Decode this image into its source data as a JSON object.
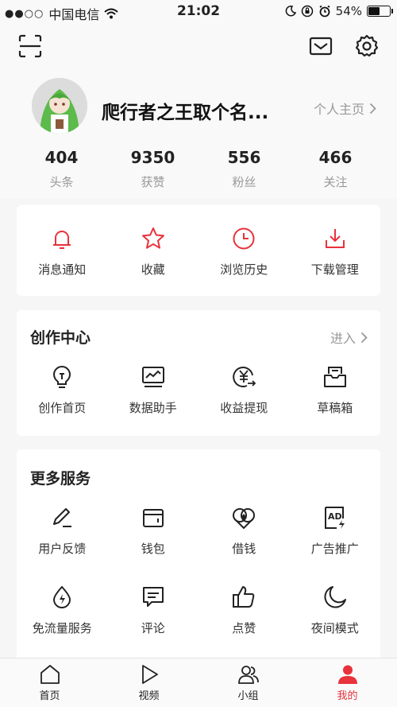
{
  "status_bar": {
    "signal_dots": "●●○○",
    "carrier": "中国电信",
    "time": "21:02",
    "battery_percent": "54%",
    "battery_level": 0.54
  },
  "profile": {
    "username": "爬行者之王取个名...",
    "homepage_link": "个人主页",
    "stats": [
      {
        "value": "404",
        "label": "头条"
      },
      {
        "value": "9350",
        "label": "获赞"
      },
      {
        "value": "556",
        "label": "粉丝"
      },
      {
        "value": "466",
        "label": "关注"
      }
    ]
  },
  "quick_actions": [
    {
      "label": "消息通知",
      "icon": "bell-icon"
    },
    {
      "label": "收藏",
      "icon": "star-icon"
    },
    {
      "label": "浏览历史",
      "icon": "clock-icon"
    },
    {
      "label": "下载管理",
      "icon": "download-icon"
    }
  ],
  "creation_center": {
    "title": "创作中心",
    "enter_label": "进入",
    "items": [
      {
        "label": "创作首页",
        "icon": "lightbulb-icon"
      },
      {
        "label": "数据助手",
        "icon": "chart-monitor-icon"
      },
      {
        "label": "收益提现",
        "icon": "yuan-coin-icon"
      },
      {
        "label": "草稿箱",
        "icon": "drafts-icon"
      }
    ]
  },
  "more_services": {
    "title": "更多服务",
    "rows": [
      [
        {
          "label": "用户反馈",
          "icon": "pen-icon"
        },
        {
          "label": "钱包",
          "icon": "wallet-icon"
        },
        {
          "label": "借钱",
          "icon": "loan-icon"
        },
        {
          "label": "广告推广",
          "icon": "ad-icon"
        }
      ],
      [
        {
          "label": "免流量服务",
          "icon": "data-drop-icon"
        },
        {
          "label": "评论",
          "icon": "comment-icon"
        },
        {
          "label": "点赞",
          "icon": "thumbs-up-icon"
        },
        {
          "label": "夜间模式",
          "icon": "moon-icon"
        }
      ]
    ]
  },
  "tabbar": [
    {
      "label": "首页",
      "icon": "home-icon",
      "active": false
    },
    {
      "label": "视频",
      "icon": "play-icon",
      "active": false
    },
    {
      "label": "小组",
      "icon": "group-icon",
      "active": false
    },
    {
      "label": "我的",
      "icon": "user-icon",
      "active": true
    }
  ],
  "colors": {
    "accent_red": "#e8323c",
    "text_dark": "#222222",
    "text_gray": "#999999",
    "background": "#f6f6f6"
  }
}
